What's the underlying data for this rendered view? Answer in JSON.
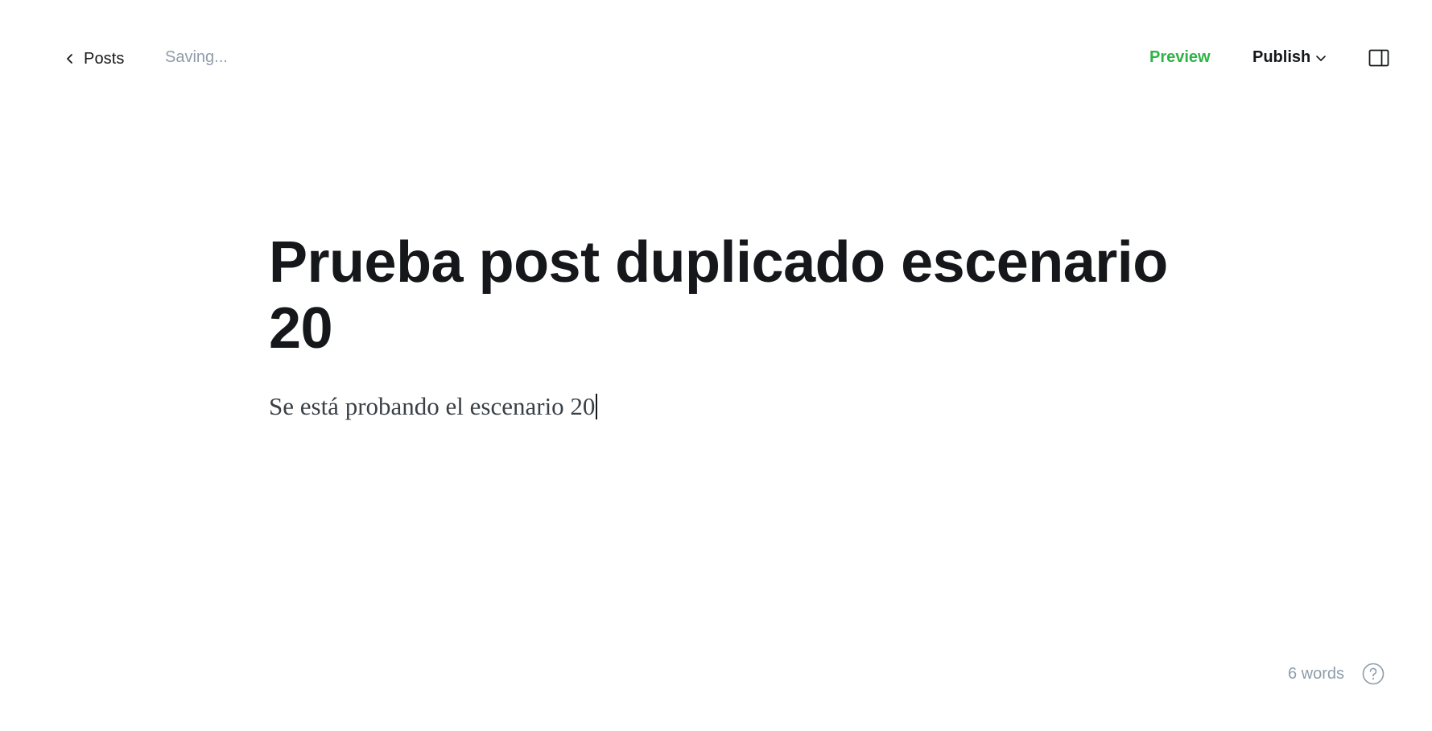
{
  "header": {
    "back_label": "Posts",
    "status_text": "Saving...",
    "preview_label": "Preview",
    "publish_label": "Publish",
    "icons": {
      "back": "chevron-left-icon",
      "publish_menu": "chevron-down-icon",
      "sidebar": "sidebar-toggle-icon"
    }
  },
  "editor": {
    "title": "Prueba post duplicado escenario 20",
    "body": "Se está probando el escenario 20"
  },
  "footer": {
    "word_count": "6 words",
    "help_icon": "question-mark-icon"
  },
  "colors": {
    "accent_green": "#2fb344",
    "muted_text": "#8e9cac",
    "primary_text": "#15171a"
  }
}
